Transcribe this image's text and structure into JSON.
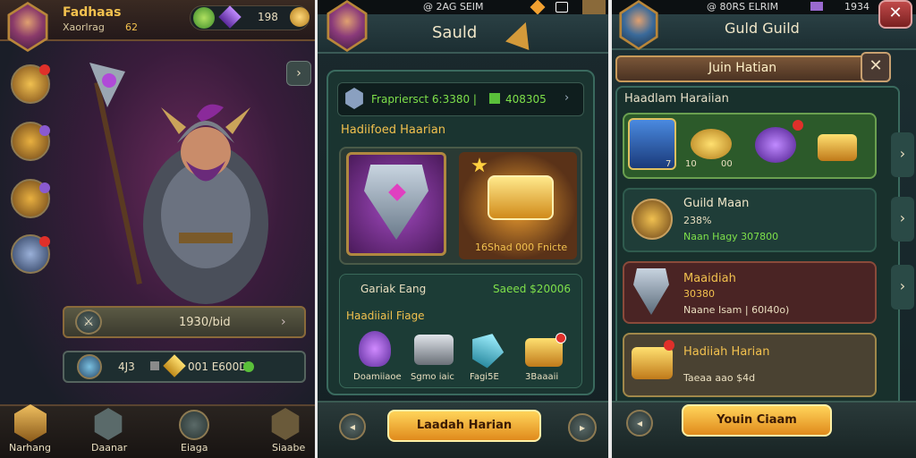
{
  "panel1": {
    "player_name": "Fadhaas",
    "player_sub": "Xaorlrag",
    "player_level": "62",
    "currency_value": "198",
    "upgrade_bar_label": "1930/bid",
    "resource_left": "4J3",
    "resource_right": "001 E600D",
    "nav": [
      {
        "label": "Narhang"
      },
      {
        "label": "Daanar"
      },
      {
        "label": "Eiaga"
      },
      {
        "label": "Siaabe"
      }
    ]
  },
  "panel2": {
    "status_text": "@ 2AG SEIM",
    "title": "Sauld",
    "stats_line": "Frapriersct 6:3380 |",
    "stats_value": "408305",
    "section1_title": "Hadiifoed Haarian",
    "reward_label": "16Shad 000 Fnicte",
    "sub_left": "Gariak Eang",
    "sub_right": "Saeed $20006",
    "section2_title": "Haadiiail Fiage",
    "items": [
      {
        "label": "Doamiiaoe"
      },
      {
        "label": "Sgmo iaic"
      },
      {
        "label": "Fagi5E"
      },
      {
        "label": "3Baaaii"
      }
    ],
    "main_button": "Laadah Harian"
  },
  "panel3": {
    "status_text": "@ 80RS ELRIM",
    "status_right": "1934",
    "title": "Guld Guild",
    "banner_title": "Juin Hatian",
    "section_title": "Haadlam Haraiian",
    "row1_badge1": "7",
    "row1_badge2": "10",
    "row1_badge3": "00",
    "row2_title": "Guild Maan",
    "row2_line1": "238%",
    "row2_line2": "Naan Hagy 307800",
    "row3_title": "Maaidiah",
    "row3_line1": "30380",
    "row3_line2": "Naane Isam | 60I40o)",
    "row4_title": "Hadiiah Harian",
    "row4_line1": "Taeaa aao $4d",
    "main_button": "Youin Ciaam"
  },
  "colors": {
    "gold": "#f2c14e",
    "green": "#7ee04a",
    "teal_panel": "#1f3d38",
    "purple_card": "#5a2a6a",
    "red_card": "#5a2626"
  }
}
